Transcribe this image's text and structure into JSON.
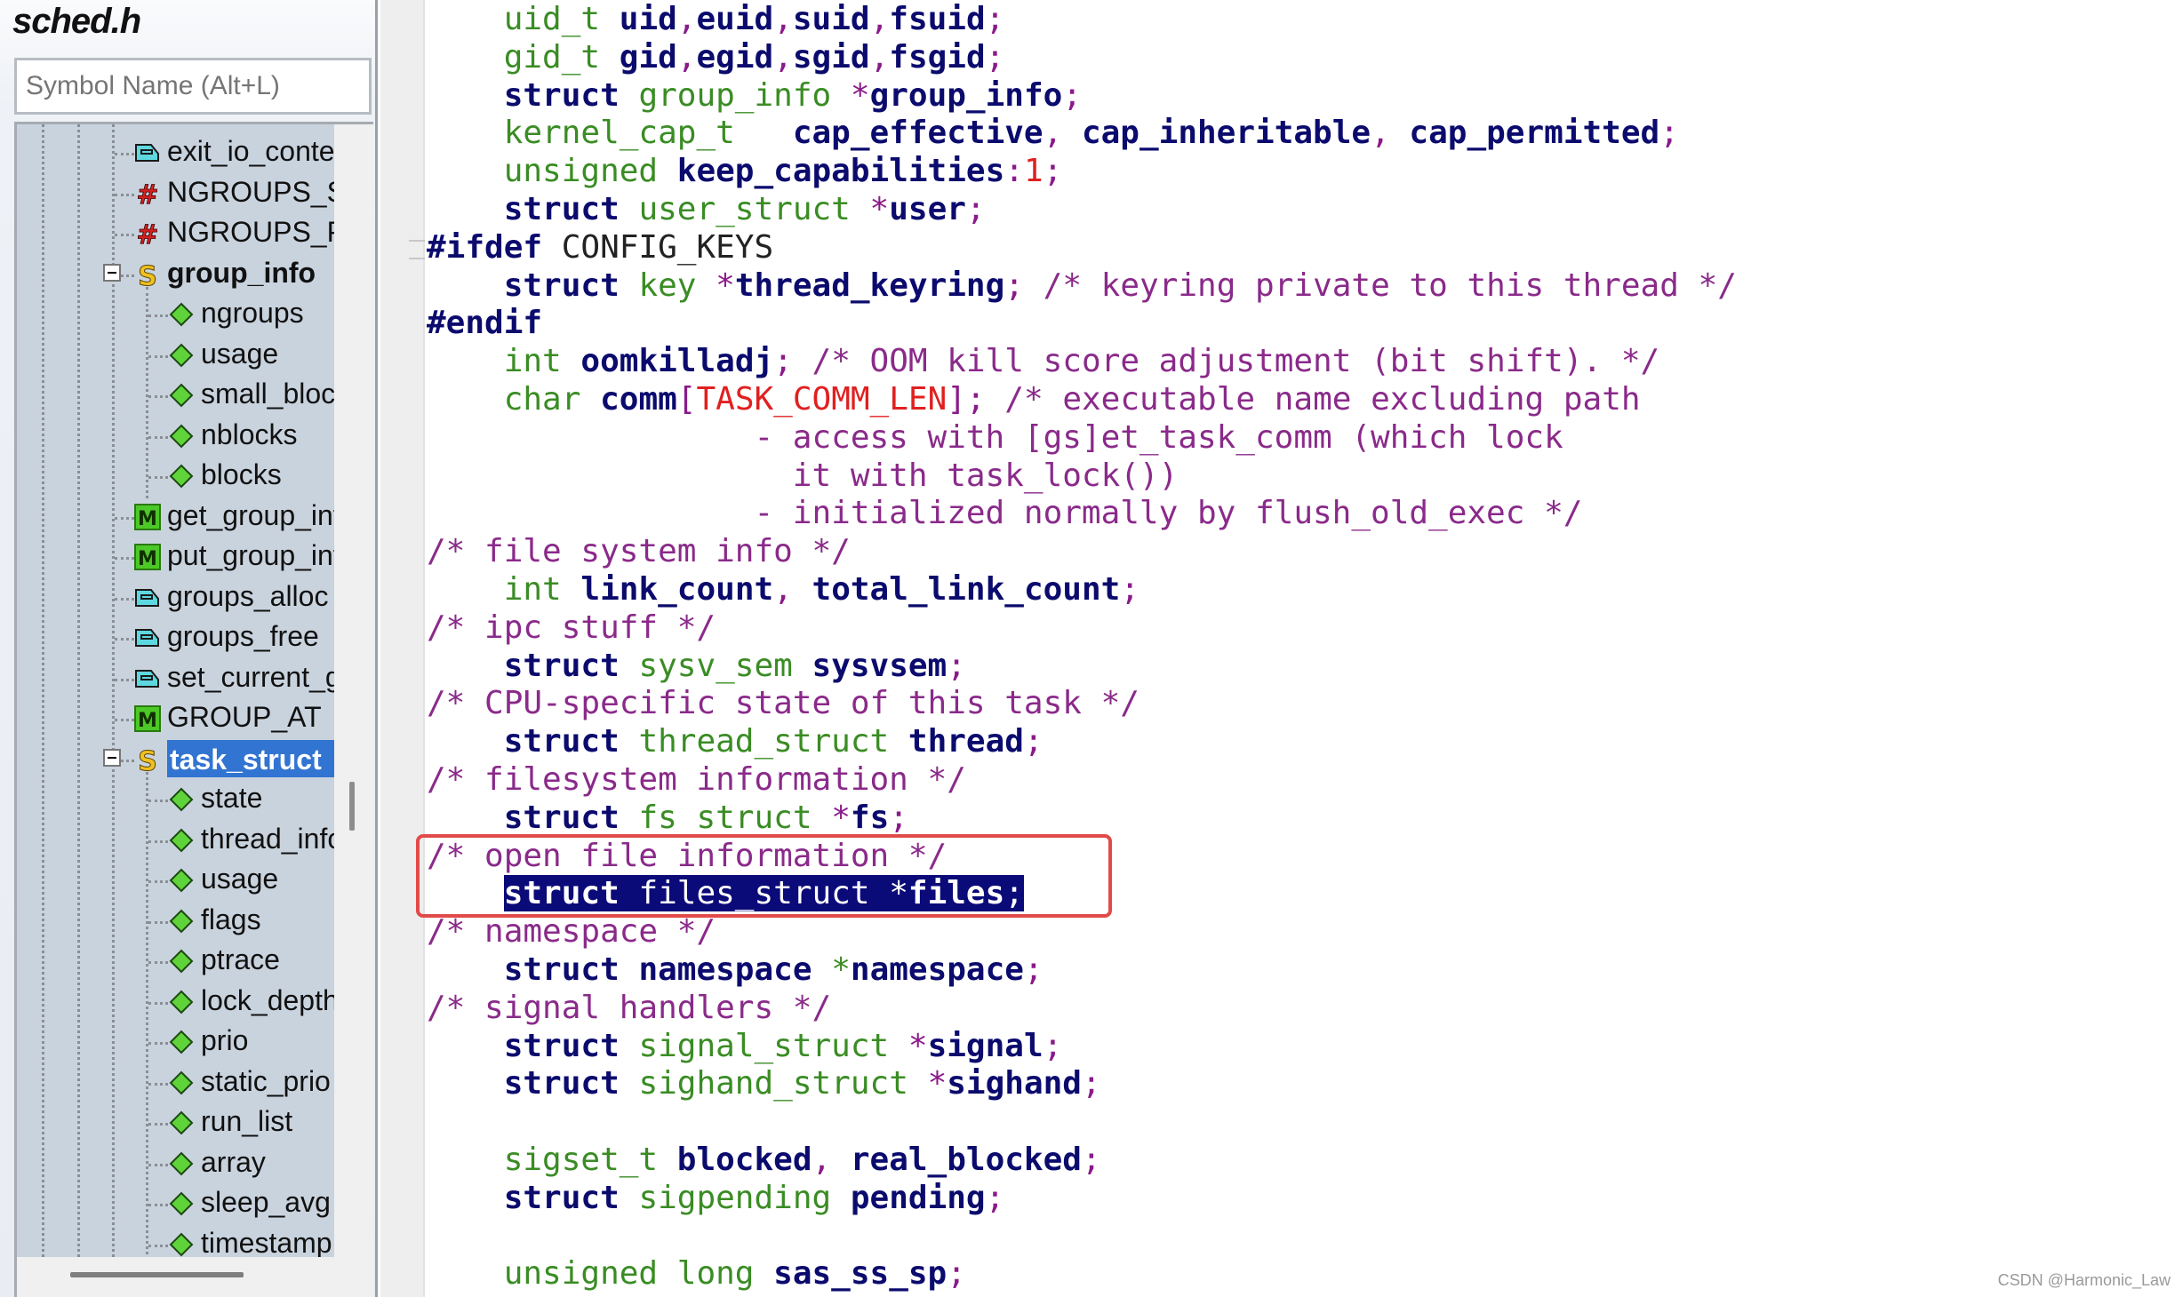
{
  "window": {
    "file_title": "sched.h",
    "search_placeholder": "Symbol Name (Alt+L)"
  },
  "symbol_tree": [
    {
      "label": "exit_io_context",
      "icon": "function-prototype-icon",
      "level": 0
    },
    {
      "label": "NGROUPS_SMALL",
      "icon": "macro-define-icon",
      "level": 0
    },
    {
      "label": "NGROUPS_PER_BLOCK",
      "icon": "macro-define-icon",
      "level": 0
    },
    {
      "label": "group_info",
      "icon": "struct-icon",
      "level": 0,
      "expanded": true,
      "bold": true
    },
    {
      "label": "ngroups",
      "icon": "member-icon",
      "level": 1
    },
    {
      "label": "usage",
      "icon": "member-icon",
      "level": 1
    },
    {
      "label": "small_block",
      "icon": "member-icon",
      "level": 1
    },
    {
      "label": "nblocks",
      "icon": "member-icon",
      "level": 1
    },
    {
      "label": "blocks",
      "icon": "member-icon",
      "level": 1
    },
    {
      "label": "get_group_info",
      "icon": "macro-function-icon",
      "level": 0
    },
    {
      "label": "put_group_info",
      "icon": "macro-function-icon",
      "level": 0
    },
    {
      "label": "groups_alloc",
      "icon": "function-prototype-icon",
      "level": 0
    },
    {
      "label": "groups_free",
      "icon": "function-prototype-icon",
      "level": 0
    },
    {
      "label": "set_current_groups",
      "icon": "function-prototype-icon",
      "level": 0
    },
    {
      "label": "GROUP_AT",
      "icon": "macro-function-icon",
      "level": 0
    },
    {
      "label": "task_struct",
      "icon": "struct-icon",
      "level": 0,
      "expanded": true,
      "selected": true
    },
    {
      "label": "state",
      "icon": "member-icon",
      "level": 1
    },
    {
      "label": "thread_info",
      "icon": "member-icon",
      "level": 1
    },
    {
      "label": "usage",
      "icon": "member-icon",
      "level": 1
    },
    {
      "label": "flags",
      "icon": "member-icon",
      "level": 1
    },
    {
      "label": "ptrace",
      "icon": "member-icon",
      "level": 1
    },
    {
      "label": "lock_depth",
      "icon": "member-icon",
      "level": 1
    },
    {
      "label": "prio",
      "icon": "member-icon",
      "level": 1
    },
    {
      "label": "static_prio",
      "icon": "member-icon",
      "level": 1
    },
    {
      "label": "run_list",
      "icon": "member-icon",
      "level": 1
    },
    {
      "label": "array",
      "icon": "member-icon",
      "level": 1
    },
    {
      "label": "sleep_avg",
      "icon": "member-icon",
      "level": 1
    },
    {
      "label": "timestamp",
      "icon": "member-icon",
      "level": 1
    }
  ],
  "code_lines": [
    [
      [
        "    ",
        ""
      ],
      [
        "uid_t",
        "t"
      ],
      [
        " ",
        ""
      ],
      [
        "uid",
        "i"
      ],
      [
        ",",
        "p"
      ],
      [
        "euid",
        "i"
      ],
      [
        ",",
        "p"
      ],
      [
        "suid",
        "i"
      ],
      [
        ",",
        "p"
      ],
      [
        "fsuid",
        "i"
      ],
      [
        ";",
        "p"
      ]
    ],
    [
      [
        "    ",
        ""
      ],
      [
        "gid_t",
        "t"
      ],
      [
        " ",
        ""
      ],
      [
        "gid",
        "i"
      ],
      [
        ",",
        "p"
      ],
      [
        "egid",
        "i"
      ],
      [
        ",",
        "p"
      ],
      [
        "sgid",
        "i"
      ],
      [
        ",",
        "p"
      ],
      [
        "fsgid",
        "i"
      ],
      [
        ";",
        "p"
      ]
    ],
    [
      [
        "    ",
        ""
      ],
      [
        "struct",
        "k"
      ],
      [
        " ",
        ""
      ],
      [
        "group_info",
        "t"
      ],
      [
        " ",
        ""
      ],
      [
        "*",
        "p"
      ],
      [
        "group_info",
        "i"
      ],
      [
        ";",
        "p"
      ]
    ],
    [
      [
        "    ",
        ""
      ],
      [
        "kernel_cap_t",
        "t"
      ],
      [
        "   ",
        ""
      ],
      [
        "cap_effective",
        "i"
      ],
      [
        ", ",
        "p"
      ],
      [
        "cap_inheritable",
        "i"
      ],
      [
        ", ",
        "p"
      ],
      [
        "cap_permitted",
        "i"
      ],
      [
        ";",
        "p"
      ]
    ],
    [
      [
        "    ",
        ""
      ],
      [
        "unsigned",
        "t"
      ],
      [
        " ",
        ""
      ],
      [
        "keep_capabilities",
        "i"
      ],
      [
        ":",
        "p"
      ],
      [
        "1",
        "n"
      ],
      [
        ";",
        "p"
      ]
    ],
    [
      [
        "    ",
        ""
      ],
      [
        "struct",
        "k"
      ],
      [
        " ",
        ""
      ],
      [
        "user_struct",
        "t"
      ],
      [
        " ",
        ""
      ],
      [
        "*",
        "p"
      ],
      [
        "user",
        "i"
      ],
      [
        ";",
        "p"
      ]
    ],
    [
      [
        "#ifdef",
        "pp"
      ],
      [
        " ",
        ""
      ],
      [
        "CONFIG_KEYS",
        "plain"
      ]
    ],
    [
      [
        "    ",
        ""
      ],
      [
        "struct",
        "k"
      ],
      [
        " ",
        ""
      ],
      [
        "key",
        "t"
      ],
      [
        " ",
        ""
      ],
      [
        "*",
        "p"
      ],
      [
        "thread_keyring",
        "i"
      ],
      [
        ";",
        "p"
      ],
      [
        " /* keyring private to this thread */",
        "c"
      ]
    ],
    [
      [
        "#endif",
        "pp"
      ]
    ],
    [
      [
        "    ",
        ""
      ],
      [
        "int",
        "t"
      ],
      [
        " ",
        ""
      ],
      [
        "oomkilladj",
        "i"
      ],
      [
        ";",
        "p"
      ],
      [
        " /* OOM kill score adjustment (bit shift). */",
        "c"
      ]
    ],
    [
      [
        "    ",
        ""
      ],
      [
        "char",
        "t"
      ],
      [
        " ",
        ""
      ],
      [
        "comm",
        "i"
      ],
      [
        "[",
        "p"
      ],
      [
        "TASK_COMM_LEN",
        "m"
      ],
      [
        "]",
        "p"
      ],
      [
        ";",
        "p"
      ],
      [
        " /* executable name excluding path",
        "c"
      ]
    ],
    [
      [
        "                 - access with [gs]et_task_comm (which lock",
        "c"
      ]
    ],
    [
      [
        "                   it with task_lock())",
        "c"
      ]
    ],
    [
      [
        "                 - initialized normally by flush_old_exec */",
        "c"
      ]
    ],
    [
      [
        "/* file system info */",
        "c"
      ]
    ],
    [
      [
        "    ",
        ""
      ],
      [
        "int",
        "t"
      ],
      [
        " ",
        ""
      ],
      [
        "link_count",
        "i"
      ],
      [
        ", ",
        "p"
      ],
      [
        "total_link_count",
        "i"
      ],
      [
        ";",
        "p"
      ]
    ],
    [
      [
        "/* ipc stuff */",
        "c"
      ]
    ],
    [
      [
        "    ",
        ""
      ],
      [
        "struct",
        "k"
      ],
      [
        " ",
        ""
      ],
      [
        "sysv_sem",
        "t"
      ],
      [
        " ",
        ""
      ],
      [
        "sysvsem",
        "i"
      ],
      [
        ";",
        "p"
      ]
    ],
    [
      [
        "/* CPU-specific state of this task */",
        "c"
      ]
    ],
    [
      [
        "    ",
        ""
      ],
      [
        "struct",
        "k"
      ],
      [
        " ",
        ""
      ],
      [
        "thread_struct",
        "t"
      ],
      [
        " ",
        ""
      ],
      [
        "thread",
        "i"
      ],
      [
        ";",
        "p"
      ]
    ],
    [
      [
        "/* filesystem information */",
        "c"
      ]
    ],
    [
      [
        "    ",
        ""
      ],
      [
        "struct",
        "k"
      ],
      [
        " ",
        ""
      ],
      [
        "fs_struct",
        "t"
      ],
      [
        " ",
        ""
      ],
      [
        "*",
        "p"
      ],
      [
        "fs",
        "i"
      ],
      [
        ";",
        "p"
      ]
    ],
    [
      [
        "/* open file information */",
        "c"
      ]
    ],
    [
      [
        "    ",
        ""
      ],
      [
        "struct",
        "k"
      ],
      [
        " ",
        ""
      ],
      [
        "files_struct",
        "t"
      ],
      [
        " ",
        ""
      ],
      [
        "*",
        "p"
      ],
      [
        "files",
        "i"
      ],
      [
        ";",
        "p"
      ]
    ],
    [
      [
        "/* namespace */",
        "c"
      ]
    ],
    [
      [
        "    ",
        ""
      ],
      [
        "struct",
        "k"
      ],
      [
        " ",
        ""
      ],
      [
        "namespace",
        "i"
      ],
      [
        " ",
        ""
      ],
      [
        "*",
        "t"
      ],
      [
        "namespace",
        "i"
      ],
      [
        ";",
        "p"
      ]
    ],
    [
      [
        "/* signal handlers */",
        "c"
      ]
    ],
    [
      [
        "    ",
        ""
      ],
      [
        "struct",
        "k"
      ],
      [
        " ",
        ""
      ],
      [
        "signal_struct",
        "t"
      ],
      [
        " ",
        ""
      ],
      [
        "*",
        "p"
      ],
      [
        "signal",
        "i"
      ],
      [
        ";",
        "p"
      ]
    ],
    [
      [
        "    ",
        ""
      ],
      [
        "struct",
        "k"
      ],
      [
        " ",
        ""
      ],
      [
        "sighand_struct",
        "t"
      ],
      [
        " ",
        ""
      ],
      [
        "*",
        "p"
      ],
      [
        "sighand",
        "i"
      ],
      [
        ";",
        "p"
      ]
    ],
    [],
    [
      [
        "    ",
        ""
      ],
      [
        "sigset_t",
        "t"
      ],
      [
        " ",
        ""
      ],
      [
        "blocked",
        "i"
      ],
      [
        ", ",
        "p"
      ],
      [
        "real_blocked",
        "i"
      ],
      [
        ";",
        "p"
      ]
    ],
    [
      [
        "    ",
        ""
      ],
      [
        "struct",
        "k"
      ],
      [
        " ",
        ""
      ],
      [
        "sigpending",
        "t"
      ],
      [
        " ",
        ""
      ],
      [
        "pending",
        "i"
      ],
      [
        ";",
        "p"
      ]
    ],
    [],
    [
      [
        "    ",
        ""
      ],
      [
        "unsigned long",
        "t"
      ],
      [
        " ",
        ""
      ],
      [
        "sas_ss_sp",
        "i"
      ],
      [
        ";",
        "p"
      ]
    ]
  ],
  "highlighted_line_index": 23,
  "annotation": {
    "boxed_lines": [
      22,
      23
    ],
    "color": "#e24a4a"
  },
  "colors": {
    "selection_bg": "#3274d1",
    "code_highlight_bg": "#0a0a78",
    "type_color": "#3a8c24",
    "identifier_color": "#0b0b6e",
    "comment_color": "#8a2a8a",
    "number_color": "#e02020"
  },
  "watermark": "CSDN @Harmonic_Law"
}
